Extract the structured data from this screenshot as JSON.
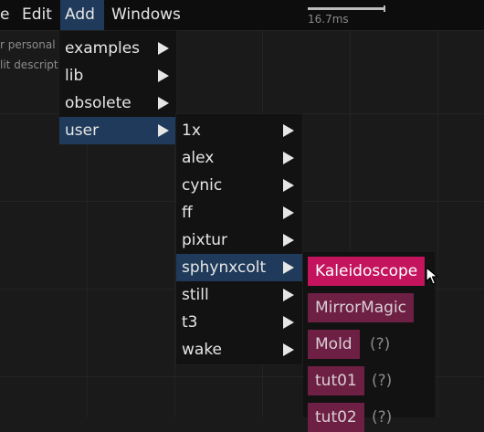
{
  "menubar": {
    "items": [
      {
        "label": "e",
        "active": false
      },
      {
        "label": "Edit",
        "active": false
      },
      {
        "label": "Add",
        "active": true
      },
      {
        "label": "Windows",
        "active": false
      }
    ],
    "frame_time": "16.7ms"
  },
  "background_text": [
    "r personal",
    "lit descript"
  ],
  "add_menu": {
    "items": [
      {
        "label": "examples",
        "submenu": true,
        "selected": false
      },
      {
        "label": "lib",
        "submenu": true,
        "selected": false
      },
      {
        "label": "obsolete",
        "submenu": true,
        "selected": false
      },
      {
        "label": "user",
        "submenu": true,
        "selected": true
      }
    ]
  },
  "user_menu": {
    "items": [
      {
        "label": "1x",
        "selected": false
      },
      {
        "label": "alex",
        "selected": false
      },
      {
        "label": "cynic",
        "selected": false
      },
      {
        "label": "ff",
        "selected": false
      },
      {
        "label": "pixtur",
        "selected": false
      },
      {
        "label": "sphynxcolt",
        "selected": true
      },
      {
        "label": "still",
        "selected": false
      },
      {
        "label": "t3",
        "selected": false
      },
      {
        "label": "wake",
        "selected": false
      }
    ]
  },
  "operators": {
    "items": [
      {
        "label": "Kaleidoscope",
        "hovered": true,
        "help": ""
      },
      {
        "label": "MirrorMagic",
        "hovered": false,
        "help": ""
      },
      {
        "label": "Mold",
        "hovered": false,
        "help": "(?)"
      },
      {
        "label": "tut01",
        "hovered": false,
        "help": "(?)"
      },
      {
        "label": "tut02",
        "hovered": false,
        "help": "(?)"
      }
    ]
  },
  "colors": {
    "selection": "#1f3a5a",
    "operator_hot": "#c4145e",
    "operator_normal": "#6e1f44"
  },
  "icons": [
    "submenu-arrow-icon",
    "mouse-cursor-icon"
  ]
}
